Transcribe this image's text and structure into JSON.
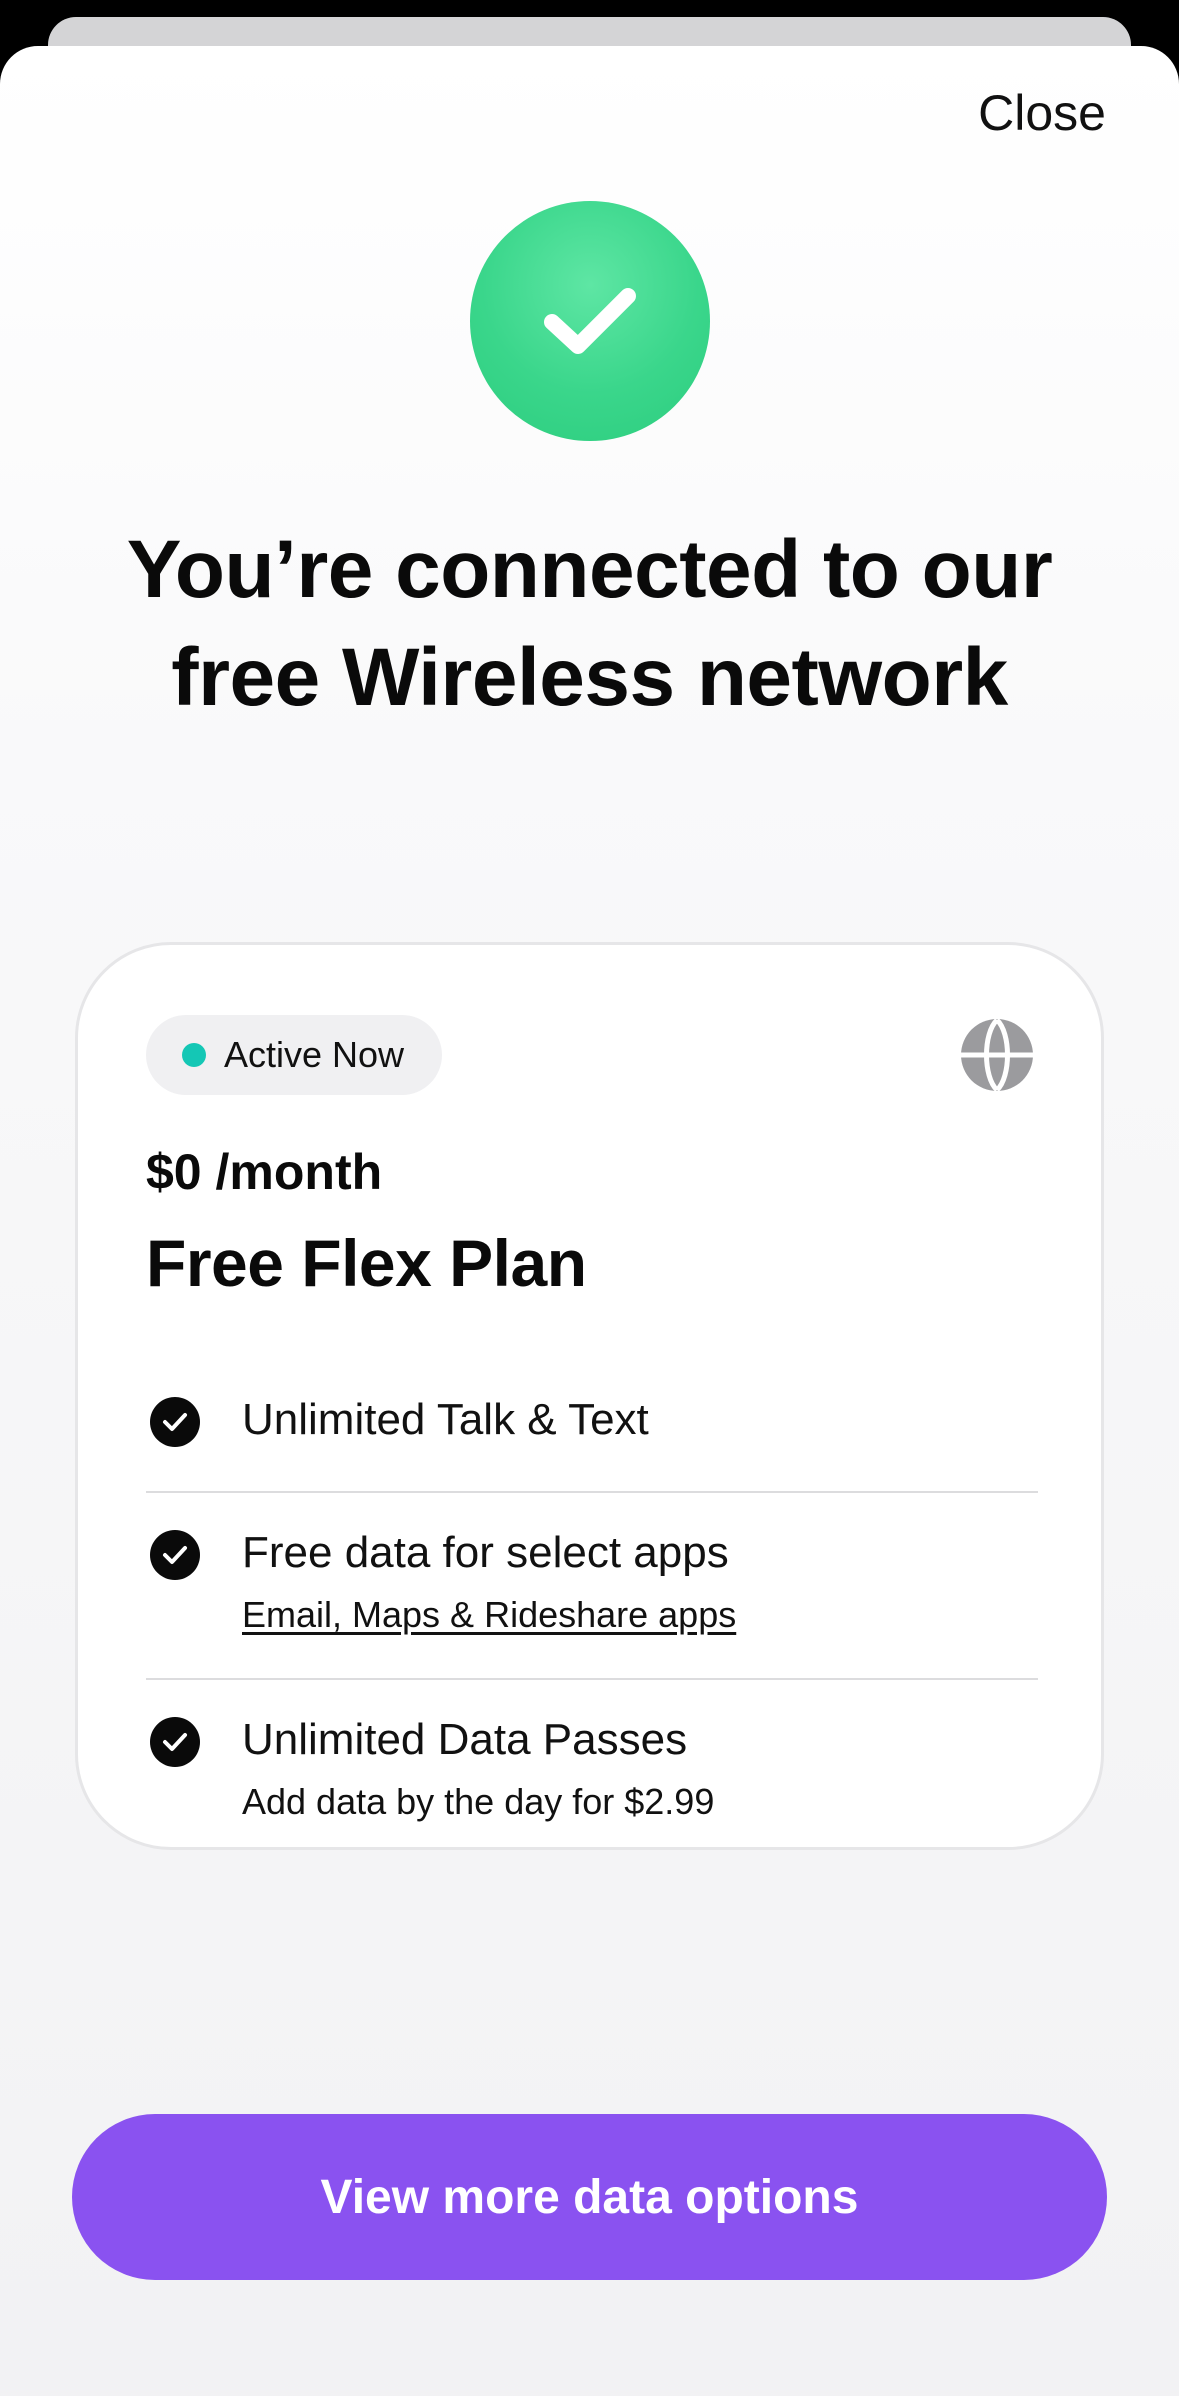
{
  "header": {
    "close_label": "Close"
  },
  "success": {
    "icon": "checkmark-icon",
    "accent_color": "#2ccd7e",
    "headline": "You’re connected to our free Wireless network"
  },
  "plan_card": {
    "status_badge": "Active Now",
    "status_color": "#14c7b5",
    "globe_icon": "globe-icon",
    "price": "$0 /month",
    "plan_name": "Free Flex Plan",
    "features": [
      {
        "title": "Unlimited Talk & Text"
      },
      {
        "title": "Free data for select apps",
        "subtitle": "Email, Maps & Rideshare apps"
      },
      {
        "title": "Unlimited Data Passes",
        "subtitle": "Add data by the day for $2.99"
      }
    ]
  },
  "cta": {
    "label": "View more data options",
    "color": "#8a52f0"
  }
}
